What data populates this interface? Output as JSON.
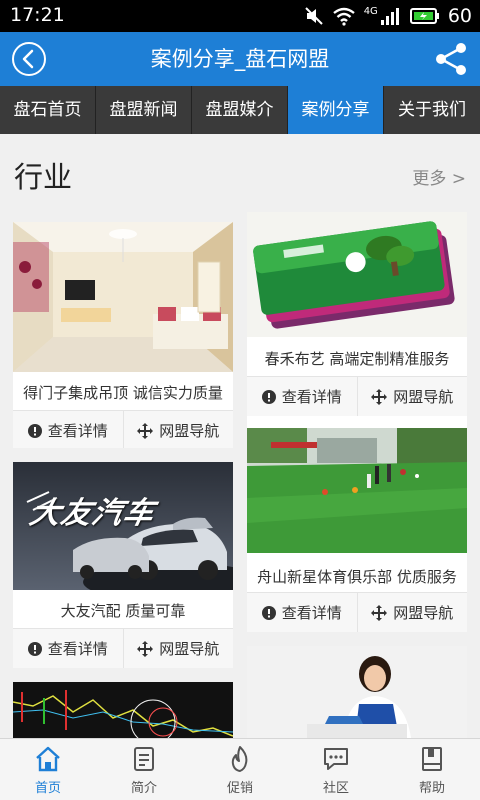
{
  "status": {
    "time": "17:21",
    "network": "4G",
    "battery": "60"
  },
  "header": {
    "title": "案例分享_盘石网盟"
  },
  "nav": {
    "tabs": [
      {
        "label": "盘石首页"
      },
      {
        "label": "盘盟新闻"
      },
      {
        "label": "盘盟媒介"
      },
      {
        "label": "案例分享"
      },
      {
        "label": "关于我们"
      }
    ]
  },
  "section": {
    "title": "行业",
    "more": "更多 >"
  },
  "cards": [
    {
      "caption": "得门子集成吊顶 诚信实力质量",
      "detail": "查看详情",
      "nav": "网盟导航"
    },
    {
      "caption": "春禾布艺 高端定制精准服务",
      "detail": "查看详情",
      "nav": "网盟导航"
    },
    {
      "caption": "大友汽配 质量可靠",
      "image_text": "大友汽车",
      "detail": "查看详情",
      "nav": "网盟导航"
    },
    {
      "caption": "舟山新星体育俱乐部 优质服务",
      "detail": "查看详情",
      "nav": "网盟导航"
    }
  ],
  "bottom": {
    "tabs": [
      {
        "label": "首页"
      },
      {
        "label": "简介"
      },
      {
        "label": "促销"
      },
      {
        "label": "社区"
      },
      {
        "label": "帮助"
      }
    ]
  },
  "colors": {
    "primary": "#1e7fd6",
    "nav_bg": "#3a3a3a"
  }
}
